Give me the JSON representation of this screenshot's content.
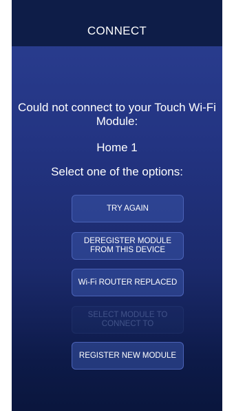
{
  "header": {
    "title": "CONNECT"
  },
  "message": {
    "text": "Could not connect to your Touch Wi-Fi Module:",
    "module_name": "Home 1",
    "prompt": "Select one of the options:"
  },
  "options": {
    "try_again": "TRY AGAIN",
    "deregister": "DEREGISTER MODULE FROM THIS DEVICE",
    "router_replaced": "Wi-Fi ROUTER REPLACED",
    "select_module": "SELECT MODULE TO CONNECT TO",
    "register_new": "REGISTER NEW MODULE"
  },
  "colors": {
    "header_bg": "#0e1d48",
    "background_top": "#2b3f92",
    "background_bottom": "#0a163d",
    "button_border": "#4b63b8"
  }
}
